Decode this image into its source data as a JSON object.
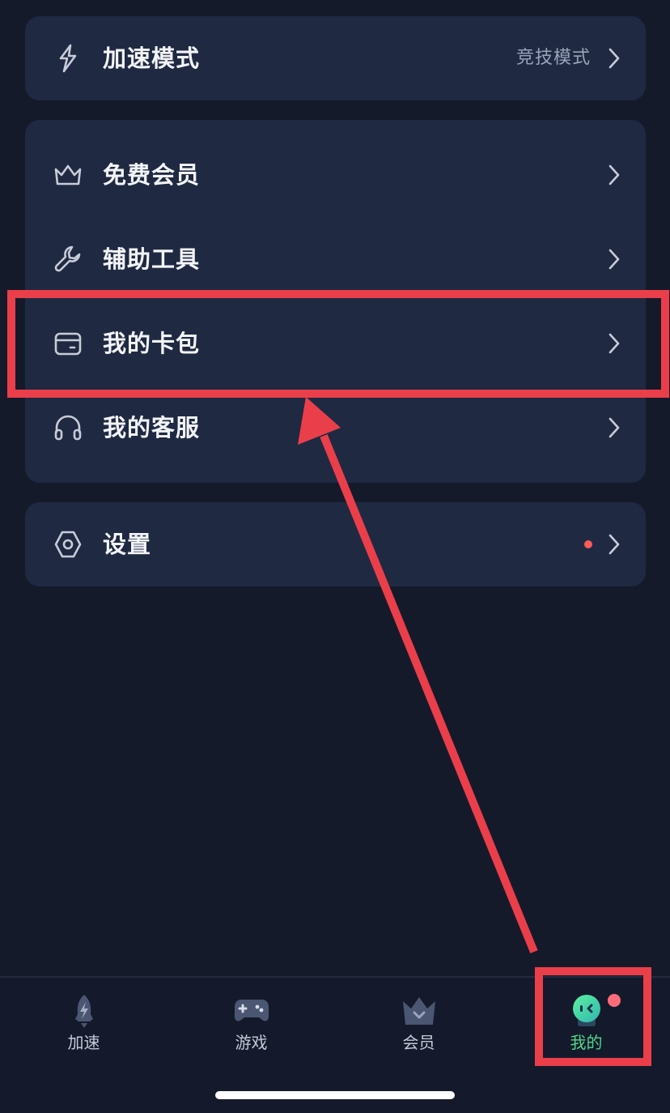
{
  "menu": {
    "mode": {
      "label": "加速模式",
      "value": "竞技模式"
    },
    "items": [
      {
        "label": "免费会员"
      },
      {
        "label": "辅助工具"
      },
      {
        "label": "我的卡包"
      },
      {
        "label": "我的客服"
      }
    ],
    "settings": {
      "label": "设置"
    }
  },
  "tabbar": {
    "tabs": [
      {
        "label": "加速"
      },
      {
        "label": "游戏"
      },
      {
        "label": "会员"
      },
      {
        "label": "我的"
      }
    ]
  },
  "colors": {
    "background": "#151a2b",
    "card": "#1f2942",
    "active_tab": "#4fd68a",
    "annotation": "#ea3f4a",
    "notification_dot": "#ff5a5a"
  }
}
